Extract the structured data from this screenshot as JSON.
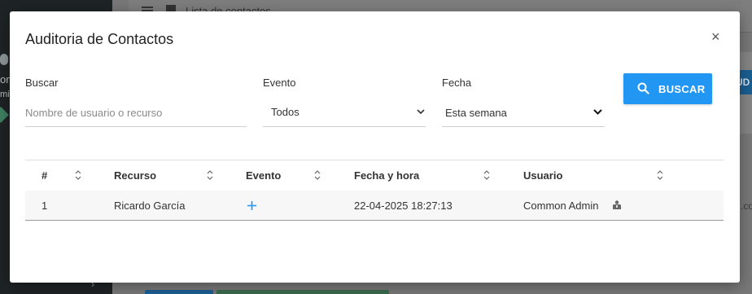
{
  "background": {
    "breadcrumb": "Lista de contactos",
    "sidebar_fragment_1": "on",
    "sidebar_fragment_2": "mis",
    "right_button_fragment": "UD",
    "right_text_fragment": ".co"
  },
  "modal": {
    "title": "Auditoria de Contactos",
    "close_label": "×"
  },
  "filters": {
    "search": {
      "label": "Buscar",
      "placeholder": "Nombre de usuario o recurso",
      "value": ""
    },
    "event": {
      "label": "Evento",
      "selected": "Todos"
    },
    "date": {
      "label": "Fecha",
      "selected": "Esta semana"
    },
    "search_button_label": "BUSCAR"
  },
  "table": {
    "columns": [
      "#",
      "Recurso",
      "Evento",
      "Fecha y hora",
      "Usuario"
    ],
    "rows": [
      {
        "index": "1",
        "resource": "Ricardo García",
        "event_icon": "plus-icon",
        "datetime": "22-04-2025 18:27:13",
        "user": "Common Admin",
        "user_icon": "user-badge-icon"
      }
    ]
  },
  "colors": {
    "accent": "#2196f3",
    "event_icon": "#2196f3",
    "text": "#333333"
  }
}
